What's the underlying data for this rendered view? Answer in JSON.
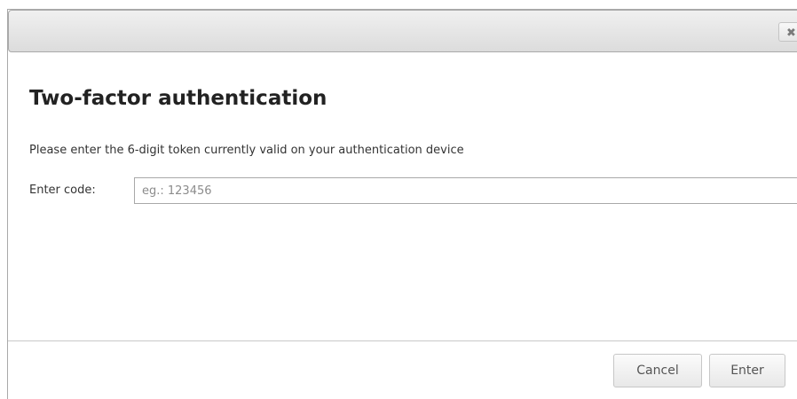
{
  "dialog": {
    "close_glyph": "✖",
    "heading": "Two-factor authentication",
    "instruction": "Please enter the 6-digit token currently valid on your authentication device",
    "code_label": "Enter code:",
    "code_input": {
      "value": "",
      "placeholder": "eg.: 123456"
    },
    "buttons": {
      "cancel_label": "Cancel",
      "enter_label": "Enter"
    }
  },
  "icons": {
    "close": "close-icon"
  },
  "colors": {
    "titlebar": "#dcdcdc",
    "text": "#333333",
    "heading": "#222222",
    "border": "#a9a9a9"
  }
}
